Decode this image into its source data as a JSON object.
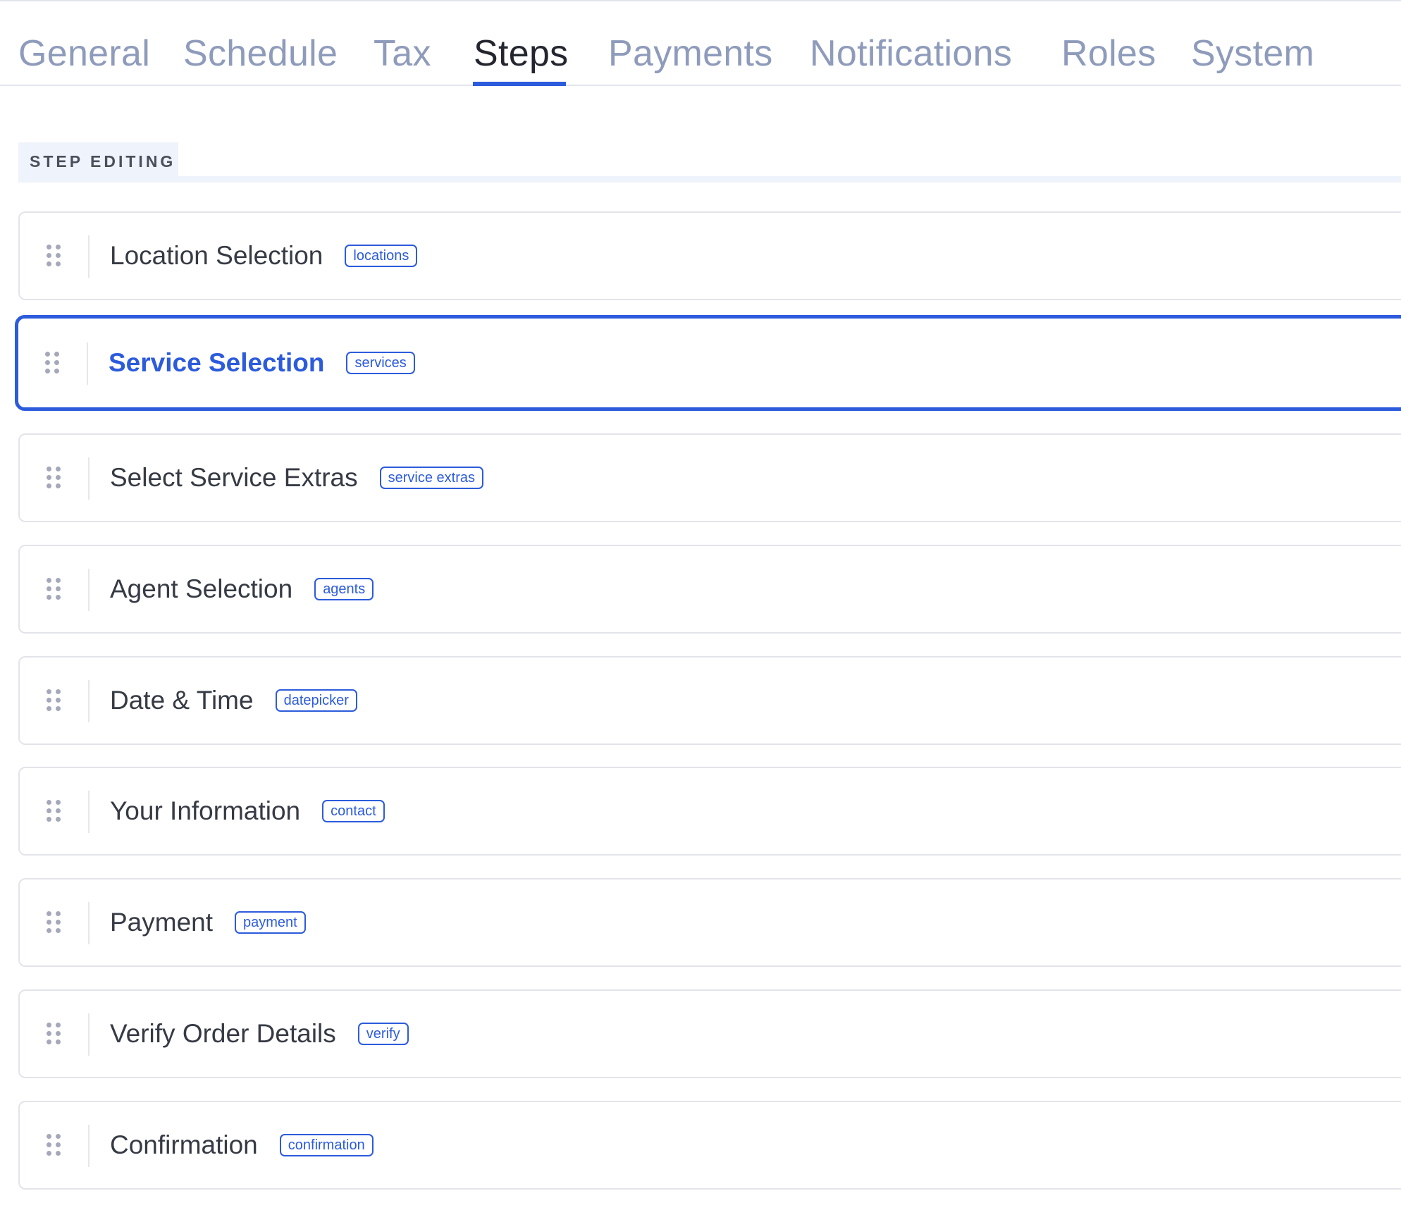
{
  "tabs": [
    {
      "label": "General",
      "active": false
    },
    {
      "label": "Schedule",
      "active": false
    },
    {
      "label": "Tax",
      "active": false
    },
    {
      "label": "Steps",
      "active": true
    },
    {
      "label": "Payments",
      "active": false
    },
    {
      "label": "Notifications",
      "active": false
    },
    {
      "label": "Roles",
      "active": false
    },
    {
      "label": "System",
      "active": false
    }
  ],
  "section": {
    "title": "STEP EDITING"
  },
  "steps": [
    {
      "title": "Location Selection",
      "code": "locations",
      "selected": false
    },
    {
      "title": "Service Selection",
      "code": "services",
      "selected": true
    },
    {
      "title": "Select Service Extras",
      "code": "service extras",
      "selected": false
    },
    {
      "title": "Agent Selection",
      "code": "agents",
      "selected": false
    },
    {
      "title": "Date & Time",
      "code": "datepicker",
      "selected": false
    },
    {
      "title": "Your Information",
      "code": "contact",
      "selected": false
    },
    {
      "title": "Payment",
      "code": "payment",
      "selected": false
    },
    {
      "title": "Verify Order Details",
      "code": "verify",
      "selected": false
    },
    {
      "title": "Confirmation",
      "code": "confirmation",
      "selected": false
    }
  ],
  "colors": {
    "accent": "#2c5bdc",
    "tab_inactive": "#8e9bbb",
    "tab_active": "#23262e",
    "text": "#363a44",
    "section_bg": "#eff3fb"
  }
}
